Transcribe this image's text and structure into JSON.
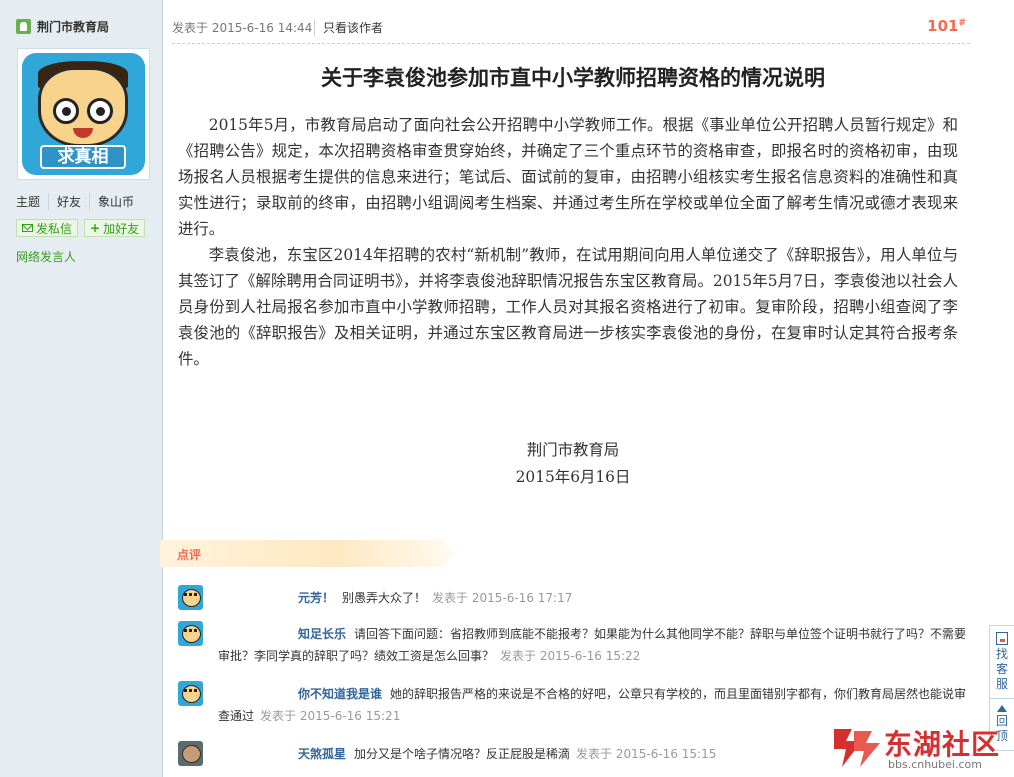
{
  "sidebar": {
    "author_name": "荆门市教育局",
    "avatar_caption": "求真相",
    "stats": [
      "主题",
      "好友",
      "象山币"
    ],
    "send_message_label": "发私信",
    "add_friend_label": "加好友",
    "spokesperson_label": "网络发言人"
  },
  "post": {
    "date": "发表于 2015-6-16 14:44",
    "only_author": "只看该作者",
    "floor": "101",
    "floor_mark": "#",
    "title": "关于李袁俊池参加市直中小学教师招聘资格的情况说明",
    "paragraphs": [
      "2015年5月，市教育局启动了面向社会公开招聘中小学教师工作。根据《事业单位公开招聘人员暂行规定》和《招聘公告》规定，本次招聘资格审查贯穿始终，并确定了三个重点环节的资格审查，即报名时的资格初审，由现场报名人员根据考生提供的信息来进行；笔试后、面试前的复审，由招聘小组核实考生报名信息资料的准确性和真实性进行；录取前的终审，由招聘小组调阅考生档案、并通过考生所在学校或单位全面了解考生情况或德才表现来进行。",
      "李袁俊池，东宝区2014年招聘的农村“新机制”教师，在试用期间向用人单位递交了《辞职报告》，用人单位与其签订了《解除聘用合同证明书》，并将李袁俊池辞职情况报告东宝区教育局。2015年5月7日，李袁俊池以社会人员身份到人社局报名参加市直中小学教师招聘，工作人员对其报名资格进行了初审。复审阶段，招聘小组查阅了李袁俊池的《辞职报告》及相关证明，并通过东宝区教育局进一步核实李袁俊池的身份，在复审时认定其符合报考条件。"
    ],
    "signature_org": "荆门市教育局",
    "signature_date": "2015年6月16日"
  },
  "comments": {
    "label": "点评",
    "items": [
      {
        "name": "元芳！",
        "text": "别愚弄大众了！",
        "date": "发表于 2015-6-16 17:17",
        "avatar": "cartoon-avatar-icon"
      },
      {
        "name": "知足长乐",
        "text": "请回答下面问题：省招教师到底能不能报考？如果能为什么其他同学不能？辞职与单位签个证明书就行了吗？不需要审批？李同学真的辞职了吗？绩效工资是怎么回事？",
        "date": "发表于 2015-6-16 15:22",
        "avatar": "cartoon-avatar-icon"
      },
      {
        "name": "你不知道我是谁",
        "text": "她的辞职报告严格的来说是不合格的好吧，公章只有学校的，而且里面错别字都有，你们教育局居然也能说审查通过",
        "date": "发表于 2015-6-16 15:21",
        "avatar": "cartoon-avatar-icon"
      },
      {
        "name": "天煞孤星",
        "text": "加分又是个啥子情况咯？反正屁股是稀滴",
        "date": "发表于 2015-6-16 15:15",
        "avatar": "photo-avatar-icon"
      }
    ]
  },
  "side_tools": {
    "find_service": "找客服",
    "back_top": "回顶"
  },
  "watermark": {
    "text": "东湖社区",
    "url": "bbs.cnhubei.com"
  },
  "colors": {
    "accent_orange": "#f26c4f",
    "link_blue": "#336699",
    "green": "#369d1d",
    "sidebar_bg": "#e5edf2",
    "brand_red": "#d62f2f"
  }
}
